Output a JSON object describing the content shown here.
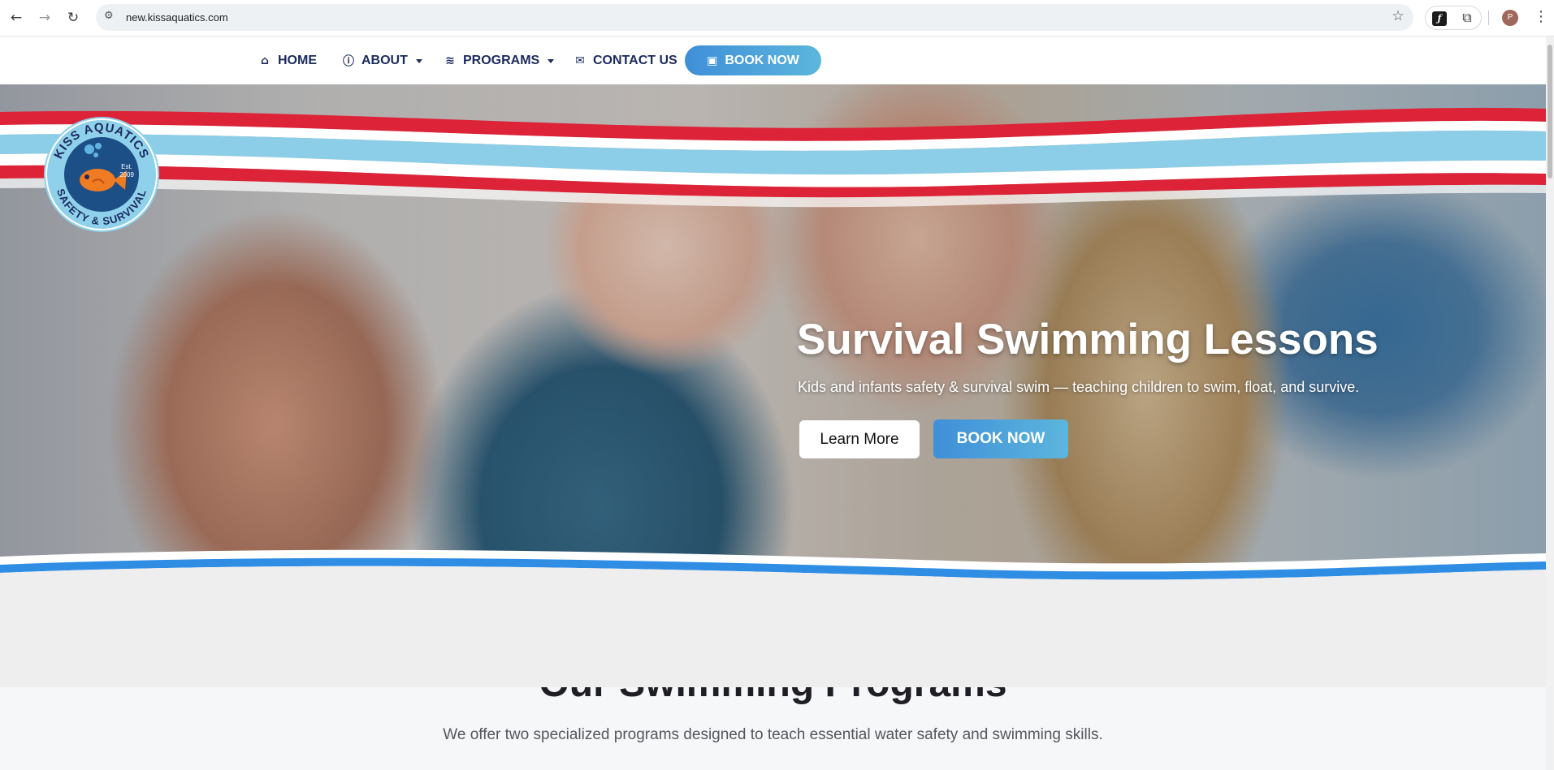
{
  "browser": {
    "url": "new.kissaquatics.com",
    "profile_initial": "P",
    "icons": {
      "back": "back-arrow-icon",
      "forward": "forward-arrow-icon",
      "reload": "reload-icon",
      "site_info": "tune-icon",
      "bookmark": "star-icon",
      "extension": "puzzle-icon",
      "menu": "kebab-menu-icon"
    }
  },
  "nav": {
    "items": [
      {
        "label": "HOME",
        "icon": "home-icon"
      },
      {
        "label": "ABOUT",
        "icon": "info-icon",
        "dropdown": true
      },
      {
        "label": "PROGRAMS",
        "icon": "waves-icon",
        "dropdown": true
      },
      {
        "label": "CONTACT US",
        "icon": "envelope-icon"
      }
    ],
    "book_button": {
      "label": "BOOK NOW",
      "icon": "calendar-check-icon"
    }
  },
  "logo": {
    "top_text": "KISS AQUATICS",
    "bottom_text": "SAFETY & SURVIVAL",
    "est_label": "Est.",
    "est_year": "2009"
  },
  "hero": {
    "title": "Survival Swimming Lessons",
    "subtitle": "Kids and infants safety & survival swim — teaching children to swim, float, and survive.",
    "learn_more": "Learn More",
    "book_now": "BOOK NOW"
  },
  "programs": {
    "title": "Our Swimming Programs",
    "subtitle": "We offer two specialized programs designed to teach essential water safety and swimming skills."
  },
  "colors": {
    "navy": "#1b2a5e",
    "brand_blue": "#3f8fd8",
    "wave_red": "#dd2338",
    "wave_light_blue": "#8ccde8",
    "accent_blue": "#2f8de4"
  }
}
